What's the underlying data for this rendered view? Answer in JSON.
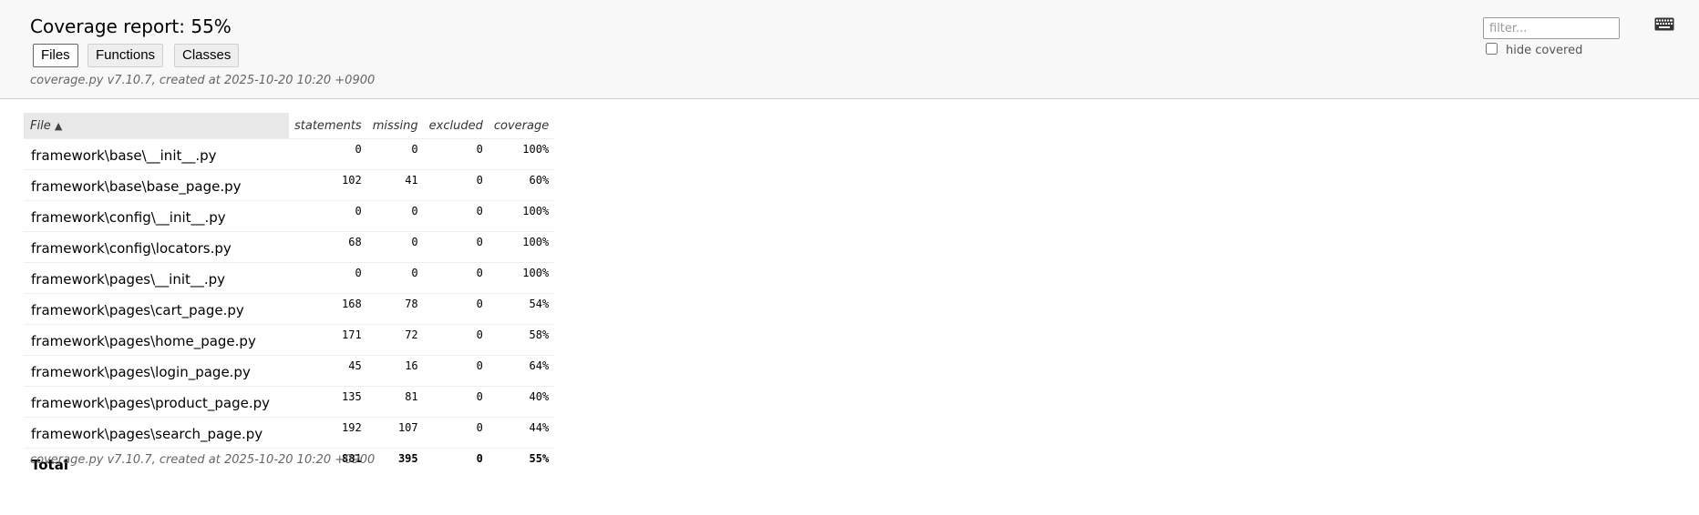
{
  "header": {
    "title": "Coverage report: 55%",
    "tabs": [
      {
        "label": "Files",
        "active": true
      },
      {
        "label": "Functions",
        "active": false
      },
      {
        "label": "Classes",
        "active": false
      }
    ],
    "created": "coverage.py v7.10.7, created at 2025-10-20 10:20 +0900",
    "filter_placeholder": "filter...",
    "hide_covered_label": "hide covered",
    "keyboard_icon": "keyboard-icon"
  },
  "table": {
    "columns": {
      "file": "File",
      "sort_indicator": "▲",
      "statements": "statements",
      "missing": "missing",
      "excluded": "excluded",
      "coverage": "coverage"
    },
    "rows": [
      {
        "file": "framework\\base\\__init__.py",
        "statements": "0",
        "missing": "0",
        "excluded": "0",
        "coverage": "100%"
      },
      {
        "file": "framework\\base\\base_page.py",
        "statements": "102",
        "missing": "41",
        "excluded": "0",
        "coverage": "60%"
      },
      {
        "file": "framework\\config\\__init__.py",
        "statements": "0",
        "missing": "0",
        "excluded": "0",
        "coverage": "100%"
      },
      {
        "file": "framework\\config\\locators.py",
        "statements": "68",
        "missing": "0",
        "excluded": "0",
        "coverage": "100%"
      },
      {
        "file": "framework\\pages\\__init__.py",
        "statements": "0",
        "missing": "0",
        "excluded": "0",
        "coverage": "100%"
      },
      {
        "file": "framework\\pages\\cart_page.py",
        "statements": "168",
        "missing": "78",
        "excluded": "0",
        "coverage": "54%"
      },
      {
        "file": "framework\\pages\\home_page.py",
        "statements": "171",
        "missing": "72",
        "excluded": "0",
        "coverage": "58%"
      },
      {
        "file": "framework\\pages\\login_page.py",
        "statements": "45",
        "missing": "16",
        "excluded": "0",
        "coverage": "64%"
      },
      {
        "file": "framework\\pages\\product_page.py",
        "statements": "135",
        "missing": "81",
        "excluded": "0",
        "coverage": "40%"
      },
      {
        "file": "framework\\pages\\search_page.py",
        "statements": "192",
        "missing": "107",
        "excluded": "0",
        "coverage": "44%"
      }
    ],
    "total": {
      "file": "Total",
      "statements": "881",
      "missing": "395",
      "excluded": "0",
      "coverage": "55%"
    }
  },
  "footer": {
    "created": "coverage.py v7.10.7, created at 2025-10-20 10:20 +0900"
  }
}
